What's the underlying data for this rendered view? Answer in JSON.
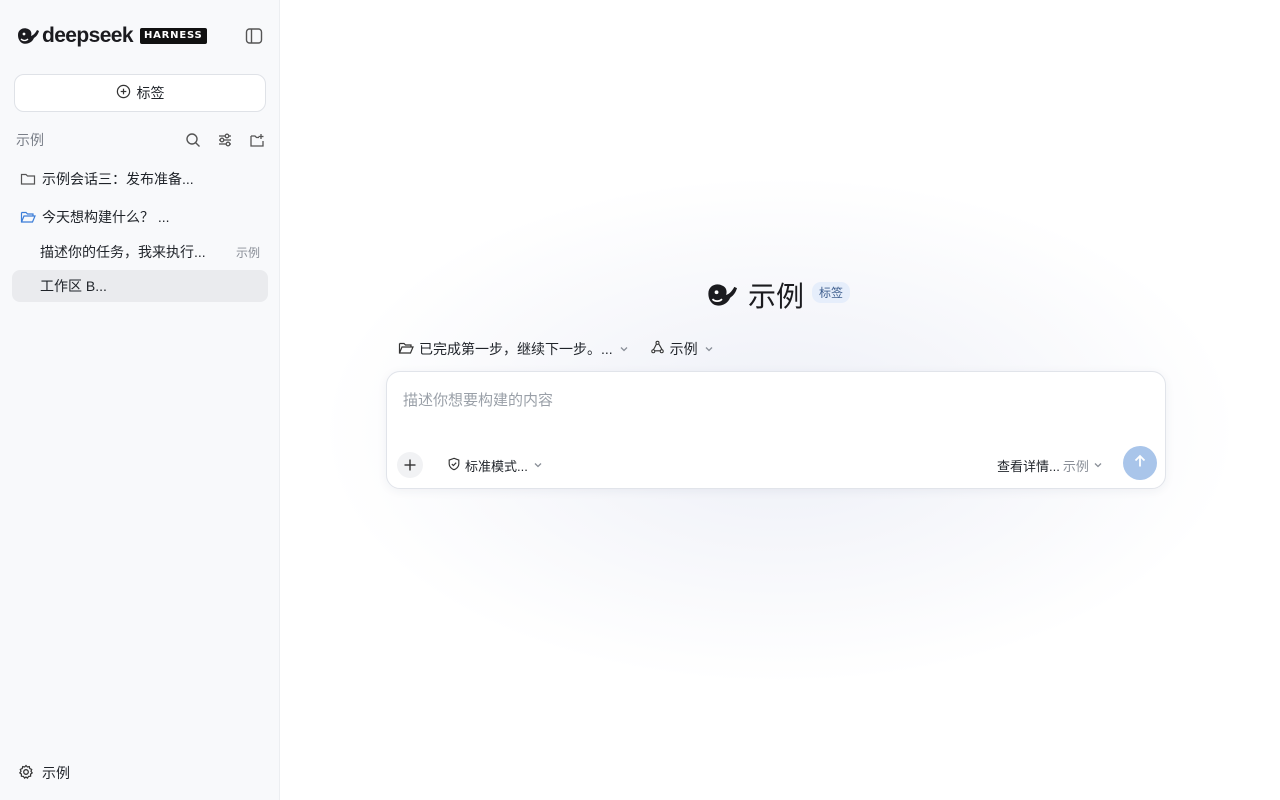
{
  "brand": {
    "name": "deepseek",
    "badge": "HARNESS"
  },
  "sidebar": {
    "new_label": "标签",
    "section_title": "示例",
    "items": [
      {
        "label": "示例会话三：发布准备...",
        "icon": "folder-icon"
      },
      {
        "label": "今天想构建什么？ ...",
        "icon": "folder-open-icon"
      }
    ],
    "subitems": [
      {
        "label": "描述你的任务，我来执行...",
        "tag": "示例"
      },
      {
        "label": "工作区 B..."
      }
    ],
    "settings_label": "示例"
  },
  "hero": {
    "title": "示例",
    "badge": "标签"
  },
  "context": {
    "folder_label": "已完成第一步，继续下一步。...",
    "agent_label": "示例"
  },
  "composer": {
    "placeholder": "描述你想要构建的内容",
    "mode_label": "标准模式...",
    "detail_label": "查看详情...",
    "detail_value": "示例"
  },
  "colors": {
    "accent": "#a9c5ea",
    "badge_bg": "#e6eefb",
    "active_bg": "#eaebee"
  }
}
